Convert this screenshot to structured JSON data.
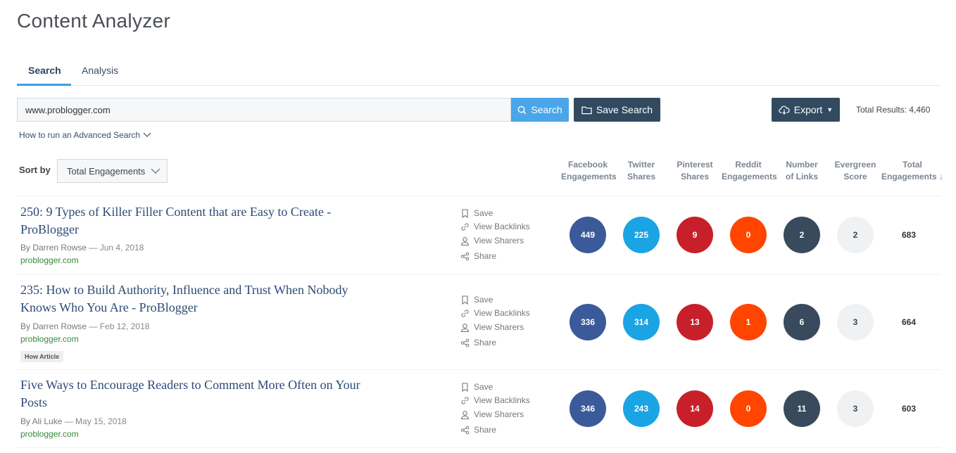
{
  "page": {
    "title": "Content Analyzer"
  },
  "tabs": {
    "search": "Search",
    "analysis": "Analysis"
  },
  "search": {
    "value": "www.problogger.com",
    "button_label": "Search",
    "save_label": "Save Search",
    "advanced_link": "How to run an Advanced Search"
  },
  "export": {
    "label": "Export"
  },
  "total_results": "Total Results: 4,460",
  "sort": {
    "label": "Sort by",
    "selected": "Total Engagements"
  },
  "columns": {
    "facebook": [
      "Facebook",
      "Engagements"
    ],
    "twitter": [
      "Twitter",
      "Shares"
    ],
    "pinterest": [
      "Pinterest",
      "Shares"
    ],
    "reddit": [
      "Reddit",
      "Engagements"
    ],
    "links": [
      "Number",
      "of Links"
    ],
    "evergreen": [
      "Evergreen",
      "Score"
    ],
    "total": [
      "Total",
      "Engagements ↓"
    ]
  },
  "actions": {
    "save": "Save",
    "backlinks": "View Backlinks",
    "sharers": "View Sharers",
    "share": "Share"
  },
  "rows": [
    {
      "title_line1": "250: 9 Types of Killer Filler Content that are Easy to Create -",
      "title_line2": "ProBlogger",
      "author": "By Darren Rowse",
      "date": "— Jun 4, 2018",
      "domain": "problogger.com",
      "tag": "",
      "facebook": "449",
      "twitter": "225",
      "pinterest": "9",
      "reddit": "0",
      "links": "2",
      "evergreen": "2",
      "total": "683"
    },
    {
      "title_line1": "235: How to Build Authority, Influence and Trust When Nobody",
      "title_line2": "Knows Who You Are - ProBlogger",
      "author": "By Darren Rowse",
      "date": "— Feb 12, 2018",
      "domain": "problogger.com",
      "tag": "How Article",
      "facebook": "336",
      "twitter": "314",
      "pinterest": "13",
      "reddit": "1",
      "links": "6",
      "evergreen": "3",
      "total": "664"
    },
    {
      "title_line1": "Five Ways to Encourage Readers to Comment More Often on Your",
      "title_line2": "Posts",
      "author": "By Ali Luke",
      "date": "— May 15, 2018",
      "domain": "problogger.com",
      "tag": "",
      "facebook": "346",
      "twitter": "243",
      "pinterest": "14",
      "reddit": "0",
      "links": "11",
      "evergreen": "3",
      "total": "603"
    }
  ],
  "icons": {
    "search": "search-icon",
    "folder": "folder-icon",
    "cloud": "cloud-download-icon",
    "caret": "caret-down-icon",
    "chevron": "chevron-down-icon",
    "bookmark": "bookmark-icon",
    "link": "link-icon",
    "user": "user-icon",
    "share": "share-icon"
  }
}
